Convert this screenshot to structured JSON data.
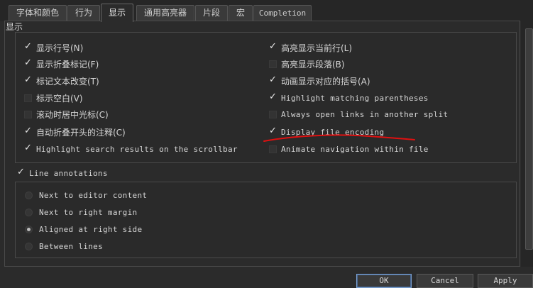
{
  "tabs": [
    {
      "label": "字体和颜色",
      "active": false
    },
    {
      "label": "行为",
      "active": false
    },
    {
      "label": "显示",
      "active": true
    },
    {
      "label": "通用高亮器",
      "active": false
    },
    {
      "label": "片段",
      "active": false
    },
    {
      "label": "宏",
      "active": false
    },
    {
      "label": "Completion",
      "active": false
    }
  ],
  "display": {
    "section_title": "显示",
    "left_options": [
      {
        "label": "显示行号(N)",
        "checked": true
      },
      {
        "label": "显示折叠标记(F)",
        "checked": true
      },
      {
        "label": "标记文本改变(T)",
        "checked": true
      },
      {
        "label": "标示空白(V)",
        "checked": false
      },
      {
        "label": "滚动时居中光标(C)",
        "checked": false
      },
      {
        "label": "自动折叠开头的注释(C)",
        "checked": true
      },
      {
        "label": "Highlight search results on the scrollbar",
        "checked": true
      }
    ],
    "right_options": [
      {
        "label": "高亮显示当前行(L)",
        "checked": true
      },
      {
        "label": "高亮显示段落(B)",
        "checked": false
      },
      {
        "label": "动画显示对应的括号(A)",
        "checked": true
      },
      {
        "label": "Highlight matching parentheses",
        "checked": true
      },
      {
        "label": "Always open links in another split",
        "checked": false
      },
      {
        "label": "Display file encoding",
        "checked": true
      },
      {
        "label": "Animate navigation within file",
        "checked": false
      }
    ]
  },
  "line_annotations": {
    "label": "Line annotations",
    "checked": true,
    "options": [
      {
        "label": "Next to editor content",
        "selected": false
      },
      {
        "label": "Next to right margin",
        "selected": false
      },
      {
        "label": "Aligned at right side",
        "selected": true
      },
      {
        "label": "Between lines",
        "selected": false
      }
    ]
  },
  "buttons": {
    "ok": "OK",
    "cancel": "Cancel",
    "apply": "Apply"
  },
  "colors": {
    "annotation_underline": "#e01010"
  }
}
